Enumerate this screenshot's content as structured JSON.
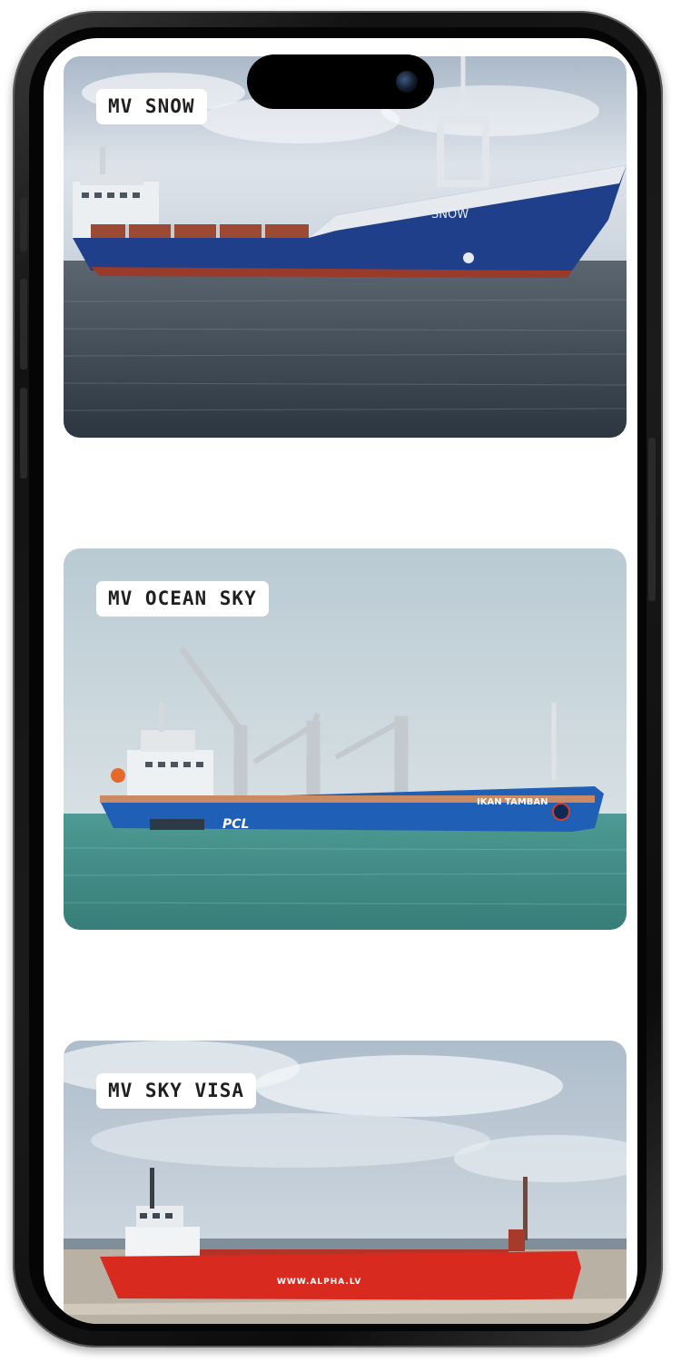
{
  "ships": [
    {
      "name": "MV SNOW",
      "hull_name": "SNOW",
      "hull_color": "#1f3f8a"
    },
    {
      "name": "MV OCEAN SKY",
      "hull_name": "IKAN TAMBAN",
      "hull_mark": "PCL",
      "hull_color": "#1f5fb5"
    },
    {
      "name": "MV SKY VISA",
      "hull_name": "WWW.ALPHA.LV",
      "hull_color": "#d92a20"
    }
  ],
  "icons": {
    "camera": "front-camera-icon"
  }
}
